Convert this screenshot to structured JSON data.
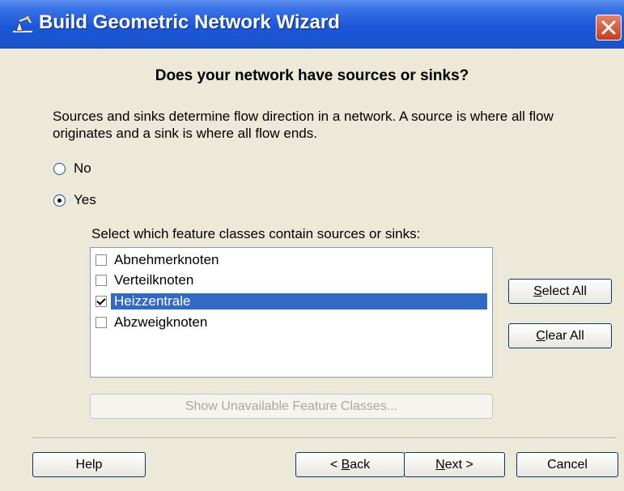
{
  "window": {
    "title": "Build Geometric Network Wizard"
  },
  "heading": "Does your network have sources or sinks?",
  "description": "Sources and sinks determine flow direction in a network. A source is where all flow originates and a sink is where all flow ends.",
  "radio_options": [
    {
      "label": "No",
      "selected": false
    },
    {
      "label": "Yes",
      "selected": true
    }
  ],
  "list_label": "Select which feature classes contain sources or sinks:",
  "feature_classes": [
    {
      "label": "Abnehmerknoten",
      "checked": false,
      "selected": false
    },
    {
      "label": "Verteilknoten",
      "checked": false,
      "selected": false
    },
    {
      "label": "Heizzentrale",
      "checked": true,
      "selected": true
    },
    {
      "label": "Abzweigknoten",
      "checked": false,
      "selected": false
    }
  ],
  "buttons": {
    "select_all": {
      "accel": "S",
      "rest": "elect All"
    },
    "clear_all": {
      "accel": "C",
      "rest": "lear All"
    },
    "show_unavailable": "Show Unavailable Feature Classes...",
    "help": "Help",
    "back": {
      "prefix": "< ",
      "accel": "B",
      "rest": "ack"
    },
    "next": {
      "accel": "N",
      "rest": "ext >"
    },
    "cancel": "Cancel"
  },
  "colors": {
    "titlebar": "#1b52c9",
    "selection": "#316ac5",
    "dialog_bg": "#ece9d8"
  }
}
